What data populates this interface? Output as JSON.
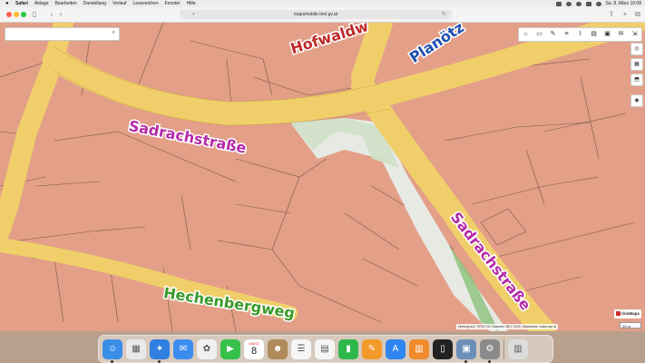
{
  "menubar": {
    "app": "Safari",
    "items": [
      "Ablage",
      "Bearbeiten",
      "Darstellung",
      "Verlauf",
      "Lesezeichen",
      "Fenster",
      "Hilfe"
    ],
    "clock": "Sa. 8. März  10:08"
  },
  "browser": {
    "url": "mapsmobile.tirol.gv.at",
    "back": "‹",
    "forward": "›",
    "share": "⇪",
    "new_tab": "+",
    "tabs": "⧉"
  },
  "map": {
    "search": {
      "value": "",
      "placeholder": ""
    },
    "streets": {
      "sadrach_west": "Sadrachstraße",
      "sadrach_east": "Sadrachstraße",
      "hofwald": "Hofwaldw",
      "planoetz": "Planötz",
      "hechenberg": "Hechenbergweg"
    },
    "tools": [
      "⌂",
      "▭",
      "✎",
      "≡",
      "⌇",
      "▤",
      "▣",
      "✉",
      "⇲"
    ],
    "side_tools": [
      "◎",
      "▦",
      "⬒",
      "◉"
    ],
    "brand": "tirisMaps",
    "attribution": "Hintergrund: TIRIS ÖK | Kataster: BEV 2025 | Basiskarte: basemap.at",
    "scale": "25 m"
  },
  "dock": {
    "apps": [
      {
        "name": "Finder",
        "glyph": "☺",
        "color": "#3b8ee8",
        "running": true
      },
      {
        "name": "Launchpad",
        "glyph": "▦",
        "color": "#e9e9e9",
        "running": false
      },
      {
        "name": "Safari",
        "glyph": "✦",
        "color": "#2f7fe0",
        "running": true
      },
      {
        "name": "Mail",
        "glyph": "✉",
        "color": "#3d8df0",
        "running": false
      },
      {
        "name": "Fotos",
        "glyph": "✿",
        "color": "#f0f0f0",
        "running": false
      },
      {
        "name": "FaceTime",
        "glyph": "▶",
        "color": "#36c24a",
        "running": false
      },
      {
        "name": "Kalender",
        "glyph": "",
        "color": "#ffffff",
        "running": false
      },
      {
        "name": "Kontakte",
        "glyph": "☻",
        "color": "#b08a5a",
        "running": false
      },
      {
        "name": "Erinnerungen",
        "glyph": "☰",
        "color": "#f6f6f6",
        "running": false
      },
      {
        "name": "Notizen",
        "glyph": "▤",
        "color": "#f6f6f6",
        "running": false
      },
      {
        "name": "Numbers",
        "glyph": "▮",
        "color": "#2fb84a",
        "running": false
      },
      {
        "name": "Pages",
        "glyph": "✎",
        "color": "#f39a2a",
        "running": false
      },
      {
        "name": "App Store",
        "glyph": "A",
        "color": "#2f86f0",
        "running": false
      },
      {
        "name": "Bücher",
        "glyph": "▥",
        "color": "#f08a2a",
        "running": false
      },
      {
        "name": "iPhone-Mirroring",
        "glyph": "▯",
        "color": "#222222",
        "running": false
      },
      {
        "name": "Vorschau",
        "glyph": "▣",
        "color": "#6c8fb8",
        "running": true
      },
      {
        "name": "Systemeinstellungen",
        "glyph": "⚙",
        "color": "#8a8a8a",
        "running": true
      },
      {
        "name": "Papierkorb",
        "glyph": "▥",
        "color": "#dcdcdc",
        "running": false
      }
    ],
    "calendar": {
      "month": "MÄRZ",
      "day": "8"
    }
  }
}
